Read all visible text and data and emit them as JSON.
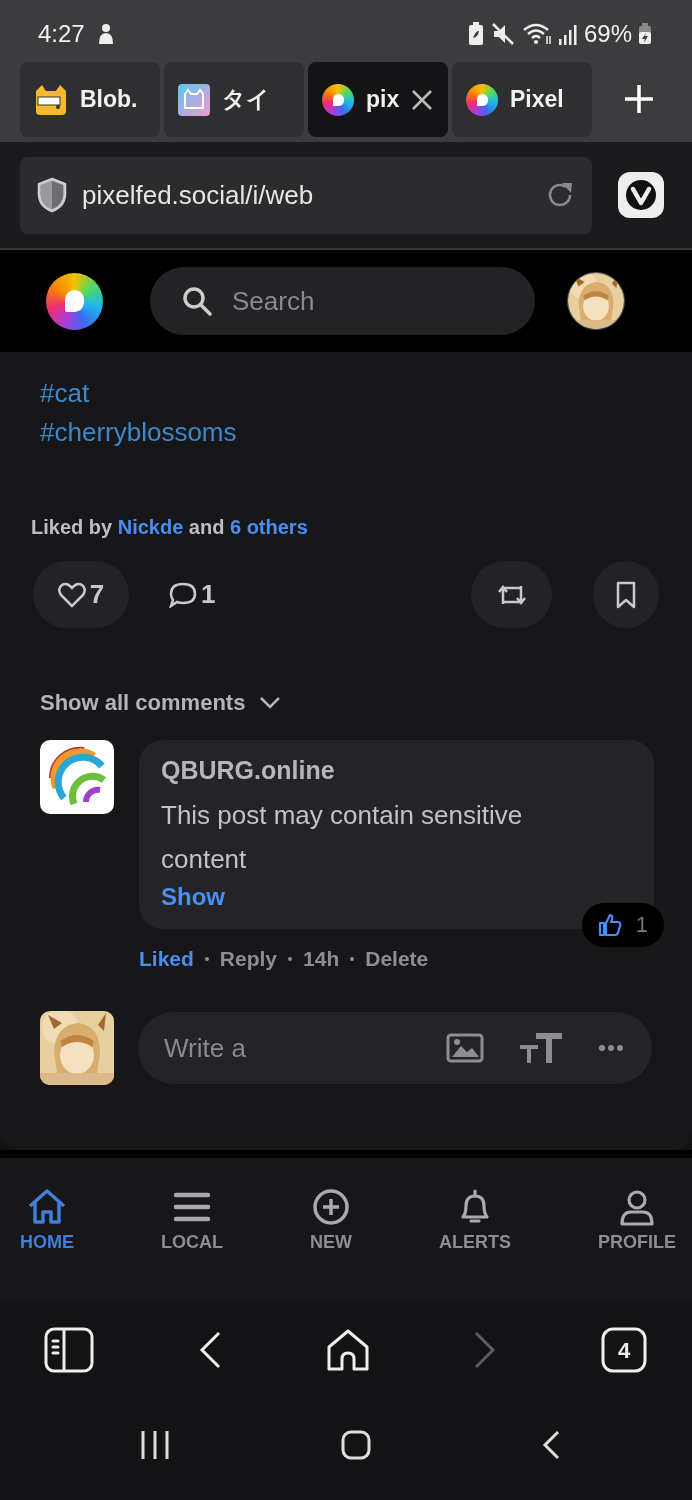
{
  "status_bar": {
    "time": "4:27",
    "battery": "69%"
  },
  "browser_tabs": [
    {
      "title": "Blob.",
      "selected": false
    },
    {
      "title": "タイ",
      "selected": false
    },
    {
      "title": "pix",
      "selected": true
    },
    {
      "title": "Pixel",
      "selected": false
    }
  ],
  "address_bar": {
    "url": "pixelfed.social/i/web"
  },
  "app_header": {
    "search": {
      "placeholder": "Search"
    }
  },
  "post": {
    "hashtags": [
      "#cat",
      "#cherryblossoms"
    ],
    "liked_by": {
      "prefix": "Liked by",
      "user": "Nickde",
      "joiner": "and",
      "others": "6 others"
    },
    "likes": {
      "count": "7",
      "liked": false
    },
    "comments": {
      "count": "1"
    },
    "show_all_comments": "Show all comments"
  },
  "comment": {
    "author": "QBURG.online",
    "text": "This post may contain sensitive content",
    "reveal": "Show",
    "reaction_count": "1",
    "meta": [
      {
        "label": "Liked",
        "selected": true
      },
      {
        "label": "Reply",
        "selected": false
      },
      {
        "label": "14h",
        "selected": false
      },
      {
        "label": "Delete",
        "selected": false
      }
    ]
  },
  "compose": {
    "placeholder": "Write a"
  },
  "bottom_nav": [
    {
      "label": "HOME",
      "selected": true
    },
    {
      "label": "LOCAL",
      "selected": false
    },
    {
      "label": "NEW",
      "selected": false
    },
    {
      "label": "ALERTS",
      "selected": false
    },
    {
      "label": "PROFILE",
      "selected": false
    }
  ],
  "browser_toolbar": {
    "tab_count": "4",
    "forward_disabled": true
  }
}
